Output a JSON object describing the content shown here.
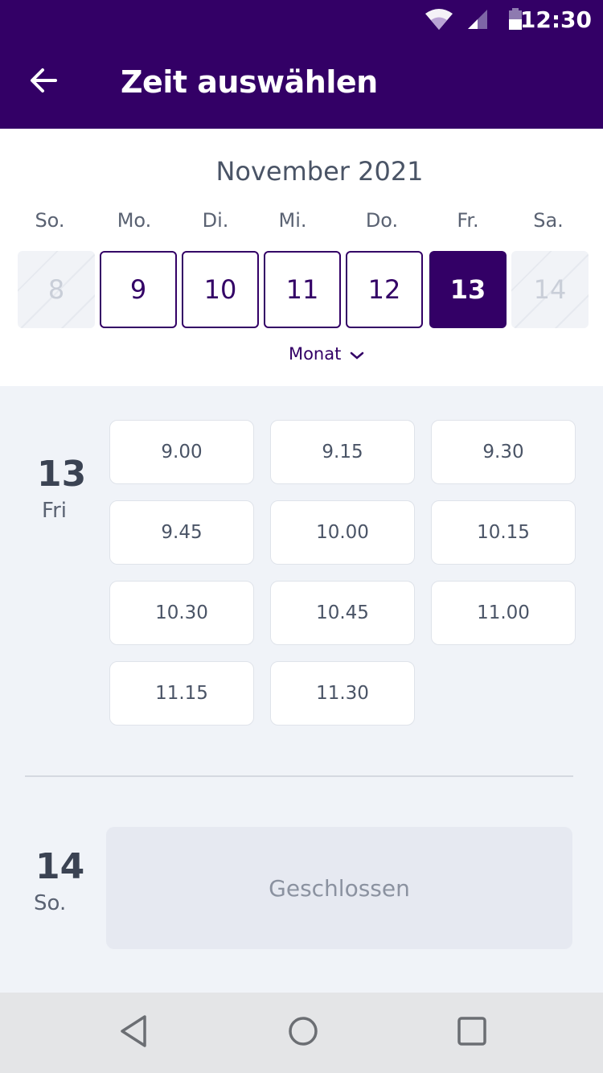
{
  "status_bar": {
    "time": "12:30"
  },
  "app_bar": {
    "title": "Zeit auswählen"
  },
  "calendar": {
    "month": "November 2021",
    "weekdays": [
      "So.",
      "Mo.",
      "Di.",
      "Mi.",
      "Do.",
      "Fr.",
      "Sa."
    ],
    "days": [
      {
        "label": "8",
        "state": "disabled"
      },
      {
        "label": "9",
        "state": "available"
      },
      {
        "label": "10",
        "state": "available"
      },
      {
        "label": "11",
        "state": "available"
      },
      {
        "label": "12",
        "state": "available"
      },
      {
        "label": "13",
        "state": "selected"
      },
      {
        "label": "14",
        "state": "disabled"
      }
    ],
    "toggle_label": "Monat"
  },
  "schedule": {
    "day1": {
      "number": "13",
      "label": "Fri",
      "slots": [
        "9.00",
        "9.15",
        "9.30",
        "9.45",
        "10.00",
        "10.15",
        "10.30",
        "10.45",
        "11.00",
        "11.15",
        "11.30"
      ]
    },
    "day2": {
      "number": "14",
      "label": "So.",
      "closed_text": "Geschlossen"
    }
  },
  "colors": {
    "primary": "#330066",
    "background": "#f0f3f8",
    "text": "#4a5466"
  }
}
